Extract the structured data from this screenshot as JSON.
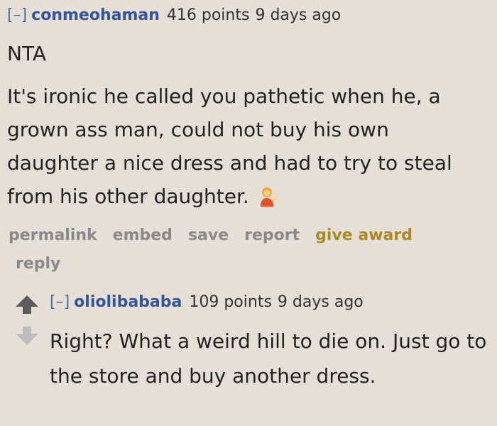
{
  "parent": {
    "collapse": "[–]",
    "author": "conmeohaman",
    "score": "416 points",
    "time": "9 days ago",
    "lines": [
      "NTA",
      "It's ironic he called you pathetic when he, a grown ass man, could not buy his own daughter a nice dress and had to try to steal from his other daughter."
    ],
    "emoji_icon": "person-tipping-hand-emoji",
    "buttons": {
      "permalink": "permalink",
      "embed": "embed",
      "save": "save",
      "report": "report",
      "give_award": "give award",
      "reply": "reply"
    }
  },
  "child": {
    "collapse": "[–]",
    "author": "oliolibababa",
    "score": "109 points",
    "time": "9 days ago",
    "text": "Right? What a weird hill to die on. Just go to the store and buy another dress.",
    "upvote_icon": "upvote-arrow-icon",
    "downvote_icon": "downvote-arrow-icon"
  },
  "colors": {
    "background": "#e6dfd5",
    "author": "#33569a",
    "buttons": "#8a8a8a",
    "award": "#a88a28"
  }
}
